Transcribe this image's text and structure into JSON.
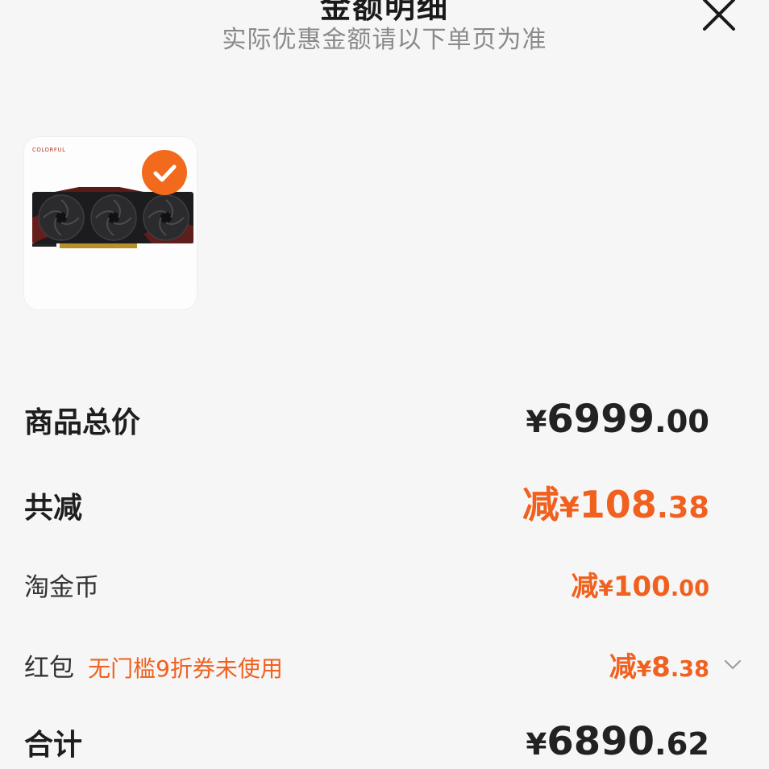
{
  "header": {
    "title": "金额明细",
    "subtitle": "实际优惠金额请以下单页为准",
    "close_icon": "close-icon"
  },
  "product": {
    "brand_text": "COLORFUL",
    "selected": true,
    "check_icon": "check-icon",
    "accent_color": "#f26a1b"
  },
  "summary": {
    "total_price": {
      "label": "商品总价",
      "yen": "¥",
      "int": "6999",
      "dec": ".00"
    },
    "discount": {
      "label": "共减",
      "prefix": "减",
      "yen": "¥",
      "int": "108",
      "dec": ".38"
    },
    "coin": {
      "label": "淘金币",
      "prefix": "减",
      "yen": "¥",
      "int": "100",
      "dec": ".00"
    },
    "redpack": {
      "label": "红包",
      "hint": "无门槛9折券未使用",
      "prefix": "减",
      "yen": "¥",
      "int": "8",
      "dec": ".38",
      "chevron_icon": "chevron-down-icon"
    },
    "sum": {
      "label": "合计",
      "yen": "¥",
      "int": "6890",
      "dec": ".62"
    }
  },
  "colors": {
    "orange": "#f0601e",
    "dark": "#222222",
    "muted": "#8a8a8a"
  }
}
